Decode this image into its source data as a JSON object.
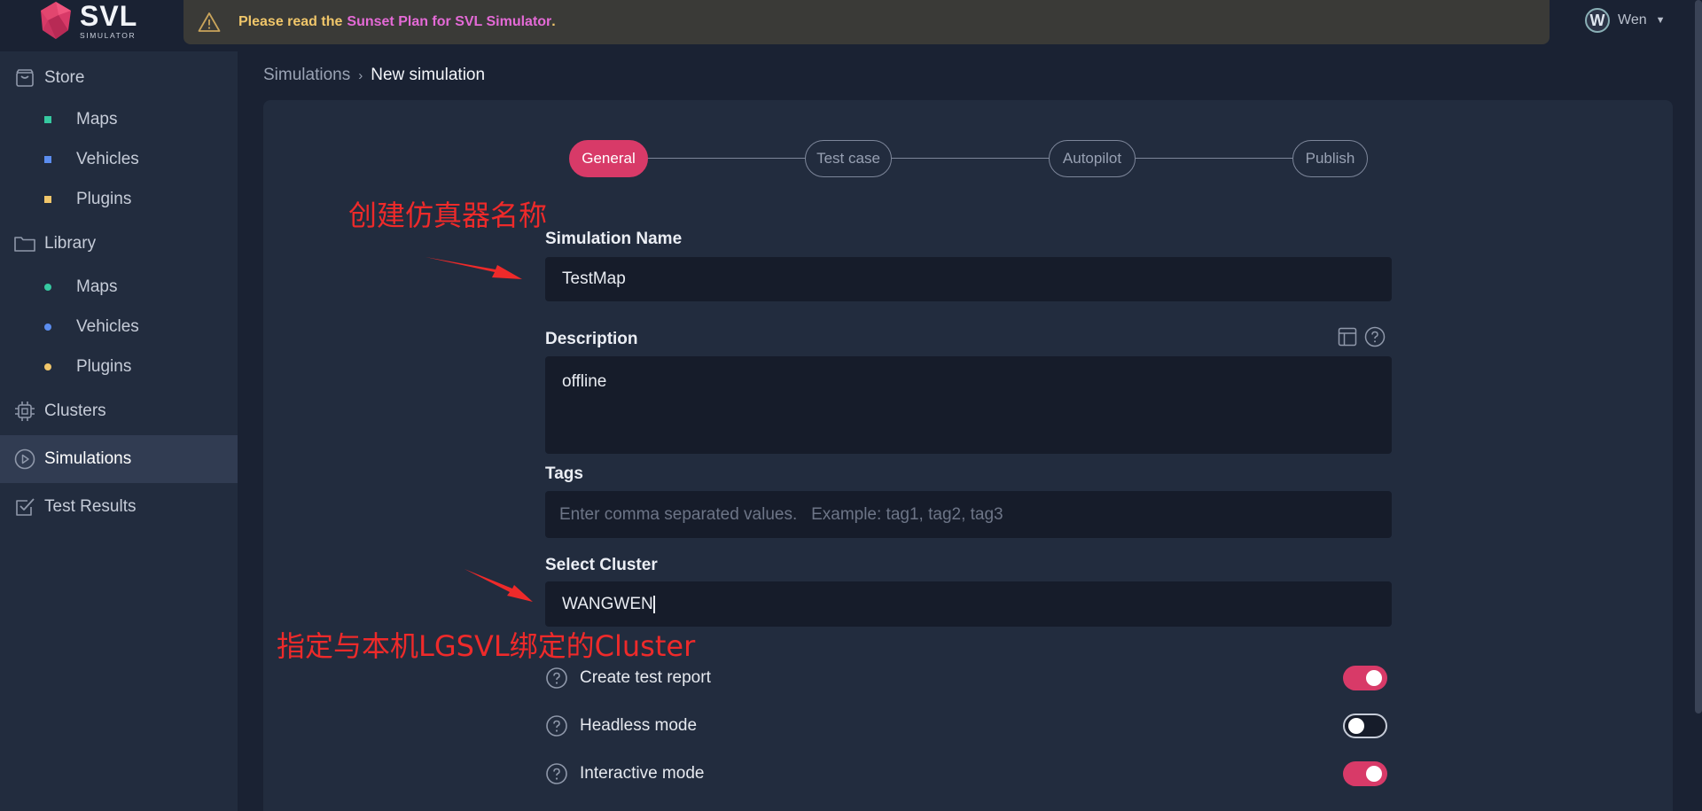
{
  "app": {
    "logo_main": "SVL",
    "logo_sub": "SIMULATOR",
    "brand_color": "#d83a68"
  },
  "banner": {
    "prefix": "Please read the",
    "link": "Sunset Plan for SVL Simulator",
    "suffix": "."
  },
  "user": {
    "initial": "W",
    "name": "Wen"
  },
  "sidebar": {
    "store": "Store",
    "store_items": [
      {
        "label": "Maps",
        "color": "#36c9a0"
      },
      {
        "label": "Vehicles",
        "color": "#5b8def"
      },
      {
        "label": "Plugins",
        "color": "#f0c66a"
      }
    ],
    "library": "Library",
    "library_items": [
      {
        "label": "Maps",
        "color": "#36c9a0"
      },
      {
        "label": "Vehicles",
        "color": "#5b8def"
      },
      {
        "label": "Plugins",
        "color": "#f0c66a"
      }
    ],
    "clusters": "Clusters",
    "simulations": "Simulations",
    "test_results": "Test Results"
  },
  "breadcrumb": {
    "parent": "Simulations",
    "separator": "›",
    "current": "New simulation"
  },
  "stepper": {
    "steps": [
      "General",
      "Test case",
      "Autopilot",
      "Publish"
    ],
    "active": "General"
  },
  "form": {
    "name_label": "Simulation Name",
    "name_value": "TestMap",
    "description_label": "Description",
    "description_value": "offline",
    "tags_label": "Tags",
    "tags_placeholder": "Enter comma separated values.   Example: tag1, tag2, tag3",
    "cluster_label": "Select Cluster",
    "cluster_value": "WANGWEN",
    "toggles": [
      {
        "label": "Create test report",
        "on": true
      },
      {
        "label": "Headless mode",
        "on": false
      },
      {
        "label": "Interactive mode",
        "on": true
      }
    ]
  },
  "annotations": {
    "name_note": "创建仿真器名称",
    "cluster_note": "指定与本机LGSVL绑定的Cluster"
  }
}
